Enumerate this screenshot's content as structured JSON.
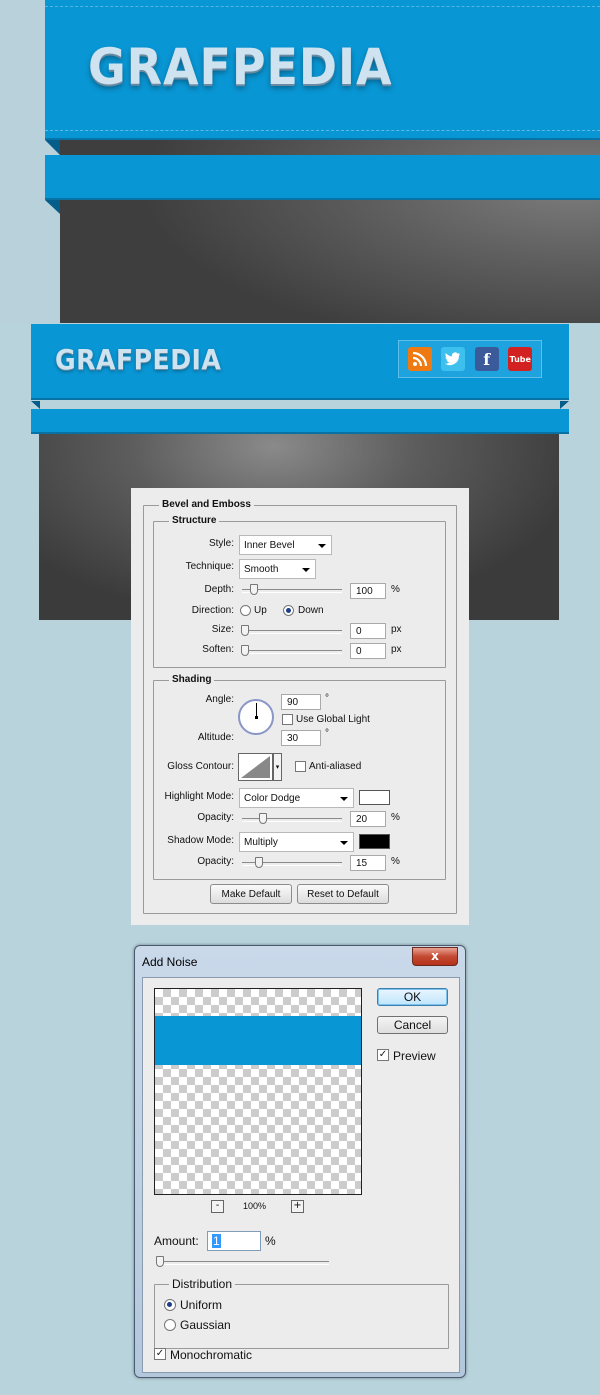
{
  "panel1": {
    "logo": "GRAFPEDIA"
  },
  "panel2": {
    "logo": "GRAFPEDIA",
    "social_icons": [
      "rss-icon",
      "twitter-icon",
      "facebook-icon",
      "youtube-icon"
    ],
    "social_glyphs": {
      "facebook": "f",
      "youtube": "Tube"
    }
  },
  "bevel": {
    "section_title": "Bevel and Emboss",
    "structure": {
      "title": "Structure",
      "style_label": "Style:",
      "style_value": "Inner Bevel",
      "technique_label": "Technique:",
      "technique_value": "Smooth",
      "depth_label": "Depth:",
      "depth_value": "100",
      "depth_unit": "%",
      "depth_level": 0.1,
      "direction_label": "Direction:",
      "direction_up": "Up",
      "direction_down": "Down",
      "direction_selected": "Down",
      "size_label": "Size:",
      "size_value": "0",
      "size_unit": "px",
      "soften_label": "Soften:",
      "soften_value": "0",
      "soften_unit": "px"
    },
    "shading": {
      "title": "Shading",
      "angle_label": "Angle:",
      "angle_value": "90",
      "angle_unit": "°",
      "global_light_label": "Use Global Light",
      "global_light_checked": false,
      "altitude_label": "Altitude:",
      "altitude_value": "30",
      "altitude_unit": "°",
      "gloss_contour_label": "Gloss Contour:",
      "anti_aliased_label": "Anti-aliased",
      "anti_aliased_checked": false,
      "highlight_mode_label": "Highlight Mode:",
      "highlight_mode_value": "Color Dodge",
      "highlight_color": "#ffffff",
      "highlight_opacity_label": "Opacity:",
      "highlight_opacity_value": "20",
      "highlight_opacity_unit": "%",
      "shadow_mode_label": "Shadow Mode:",
      "shadow_mode_value": "Multiply",
      "shadow_color": "#000000",
      "shadow_opacity_label": "Opacity:",
      "shadow_opacity_value": "15",
      "shadow_opacity_unit": "%"
    },
    "buttons": {
      "make_default": "Make Default",
      "reset_default": "Reset to Default"
    }
  },
  "noise": {
    "title": "Add Noise",
    "close": "x",
    "ok": "OK",
    "cancel": "Cancel",
    "preview_label": "Preview",
    "preview_checked": true,
    "zoom_out": "-",
    "zoom_in": "+",
    "zoom_level": "100%",
    "amount_label": "Amount:",
    "amount_value": "1",
    "amount_unit": "%",
    "distribution_title": "Distribution",
    "uniform": "Uniform",
    "gaussian": "Gaussian",
    "distribution_selected": "Uniform",
    "monochromatic_label": "Monochromatic",
    "monochromatic_checked": true
  },
  "colors": {
    "brand_blue": "#0996d4",
    "wall_gray": "#5f5f5f",
    "background": "#b8d3dc"
  }
}
